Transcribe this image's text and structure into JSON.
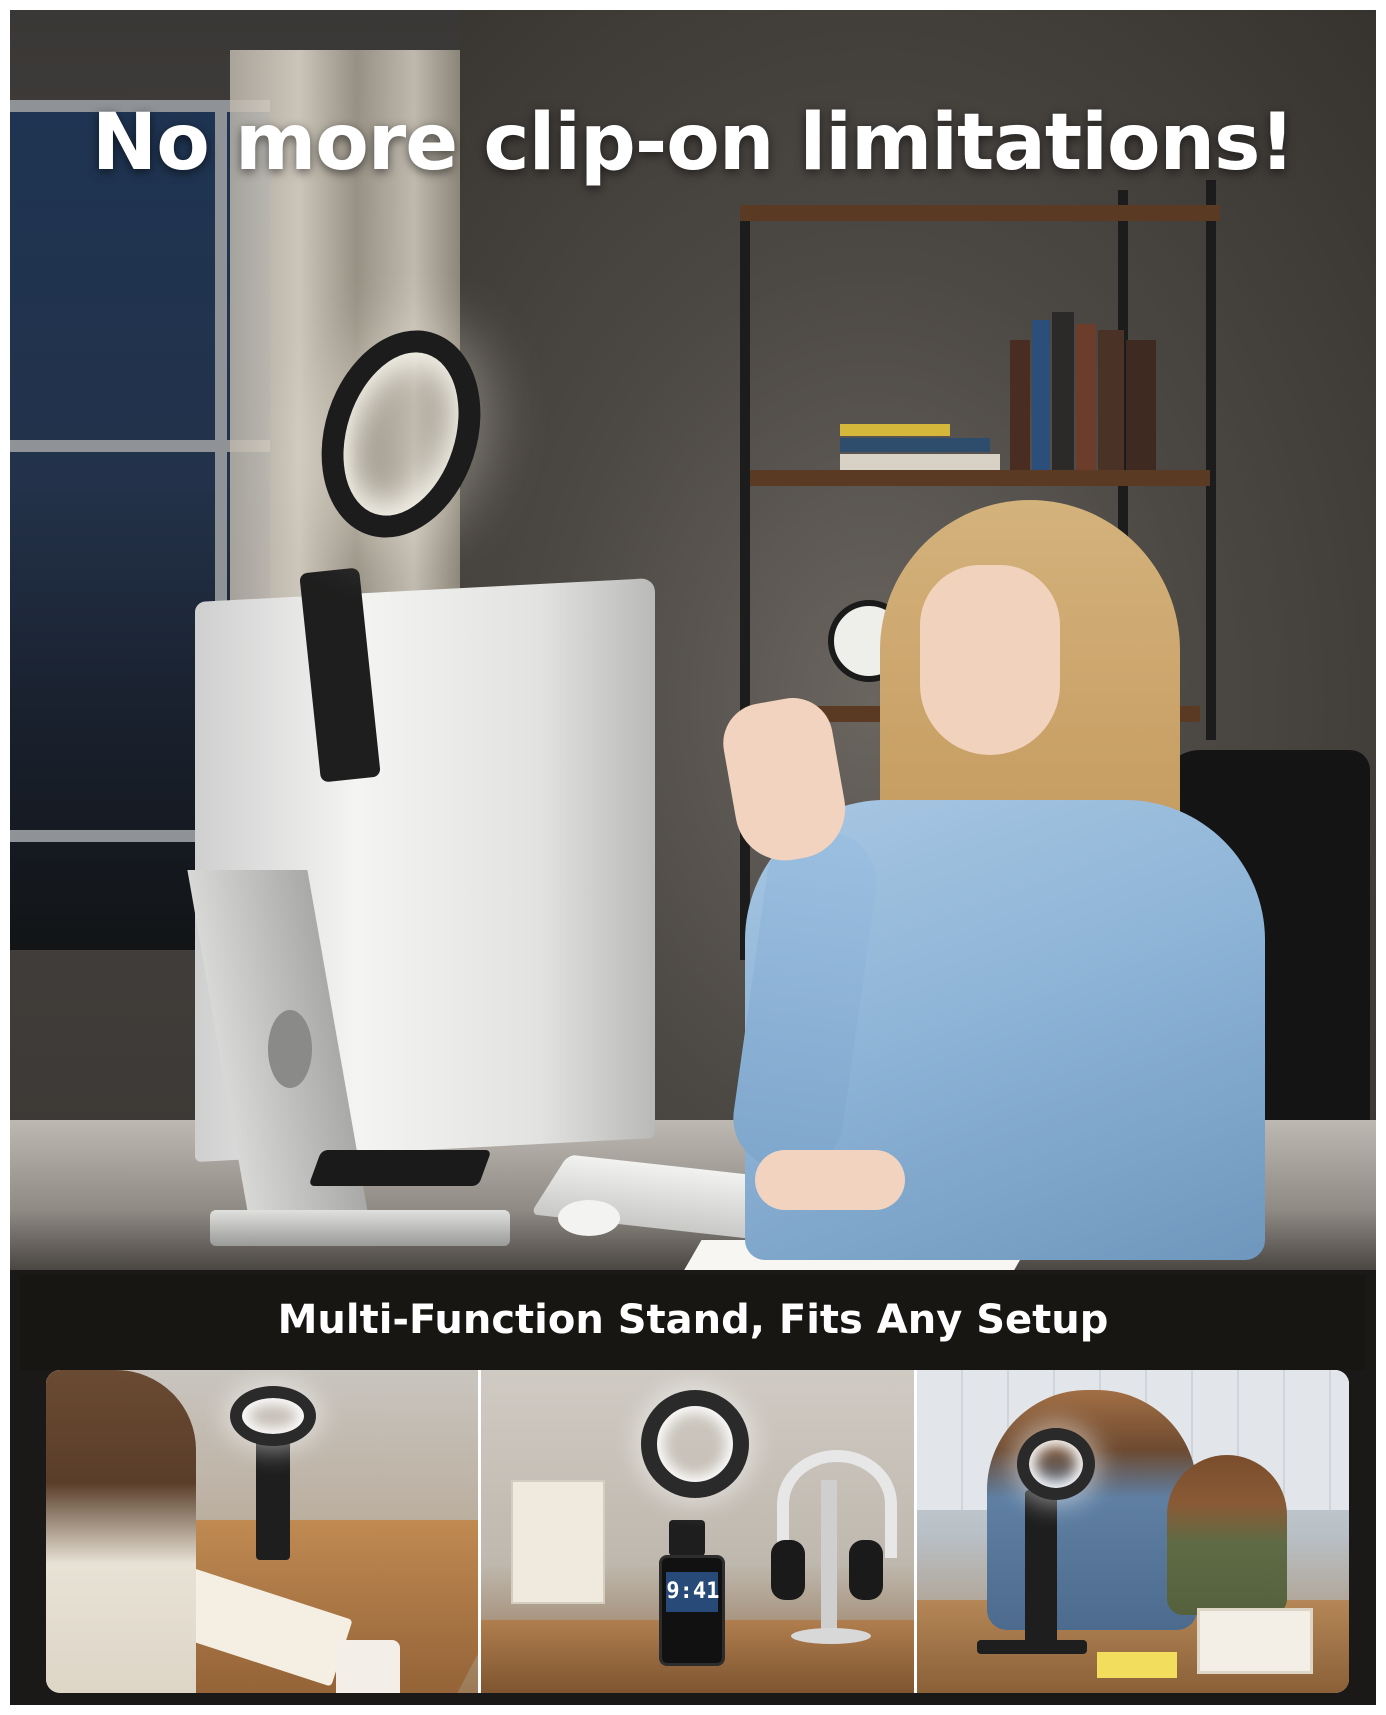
{
  "headline": "No more clip-on limitations!",
  "subheadline": "Multi-Function Stand, Fits Any Setup",
  "panels": [
    {
      "name": "reading-scene"
    },
    {
      "name": "phone-stand-scene",
      "phone_time": "9:41"
    },
    {
      "name": "family-puzzle-scene"
    }
  ],
  "colors": {
    "text": "#ffffff",
    "band": "#181614",
    "shirt": "#8bb2d5",
    "hair": "#c69d62"
  }
}
